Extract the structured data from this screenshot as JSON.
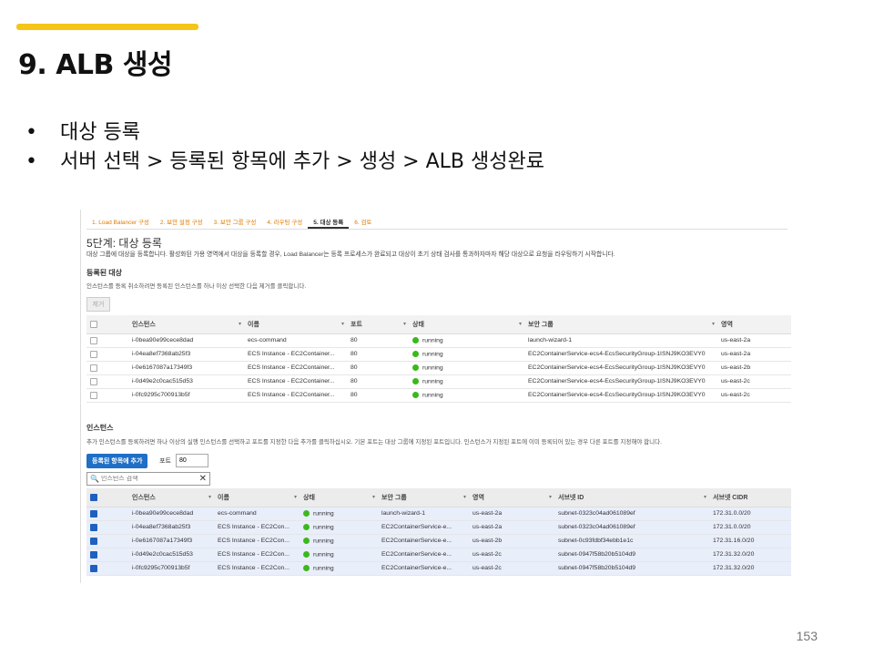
{
  "slide": {
    "title": "9. ALB 생성",
    "bullets": [
      "대상 등록",
      "서버 선택 > 등록된 항목에 추가  > 생성 > ALB 생성완료"
    ],
    "page_number": "153",
    "accent_color": "#f5c518"
  },
  "wizard": {
    "tabs": [
      "1. Load Balancer 구성",
      "2. 보안 설정 구성",
      "3. 보안 그룹 구성",
      "4. 라우팅 구성",
      "5. 대상 등록",
      "6. 검토"
    ],
    "active_tab": "5. 대상 등록",
    "step_title": "5단계: 대상 등록",
    "step_desc": "대상 그룹에 대상을 등록합니다. 활성화된 가용 영역에서 대상을 등록할 경우, Load Balancer는 등록 프로세스가 완료되고 대상이 초기 상태 검사를 통과하자마자 해당 대상으로 요청을 라우팅하기 시작합니다."
  },
  "registered": {
    "heading": "등록된 대상",
    "desc": "인스턴스를 등록 취소하려면 등록된 인스턴스를 하나 이상 선택한 다음 제거를 클릭합니다.",
    "remove_label": "제거",
    "columns": [
      "인스턴스",
      "이름",
      "포트",
      "상태",
      "보안 그룹",
      "영역"
    ],
    "rows": [
      [
        "i-0bea90e99cece8dad",
        "ecs-command",
        "80",
        "running",
        "launch-wizard-1",
        "us-east-2a"
      ],
      [
        "i-04ea8ef7368ab25f3",
        "ECS Instance - EC2Container...",
        "80",
        "running",
        "EC2ContainerService-ecs4-EcsSecurityGroup-1ISNJ9KO3EVY0",
        "us-east-2a"
      ],
      [
        "i-0e6167087a17349f3",
        "ECS Instance - EC2Container...",
        "80",
        "running",
        "EC2ContainerService-ecs4-EcsSecurityGroup-1ISNJ9KO3EVY0",
        "us-east-2b"
      ],
      [
        "i-0d49e2c0cac515d53",
        "ECS Instance - EC2Container...",
        "80",
        "running",
        "EC2ContainerService-ecs4-EcsSecurityGroup-1ISNJ9KO3EVY0",
        "us-east-2c"
      ],
      [
        "i-0fc9295c700913b5f",
        "ECS Instance - EC2Container...",
        "80",
        "running",
        "EC2ContainerService-ecs4-EcsSecurityGroup-1ISNJ9KO3EVY0",
        "us-east-2c"
      ]
    ]
  },
  "instances": {
    "heading": "인스턴스",
    "desc": "추가 인스턴스를 등록하려면 하나 이상의 실행 인스턴스를 선택하고 포트를 지정한 다음 추가를 클릭하십시오. 기본 포트는 대상 그룹에 지정된 포트입니다. 인스턴스가 지정된 포트에 이미 등록되어 있는 경우 다른 포트를 지정해야 합니다.",
    "add_label": "등록된 항목에 추가",
    "port_label": "포트",
    "port_value": "80",
    "search_placeholder": "인스턴스 검색",
    "columns": [
      "인스턴스",
      "이름",
      "상태",
      "보안 그룹",
      "영역",
      "서브넷 ID",
      "서브넷 CIDR"
    ],
    "rows": [
      [
        "i-0bea90e99cece8dad",
        "ecs-command",
        "running",
        "launch-wizard-1",
        "us-east-2a",
        "subnet-0323c04ad061089ef",
        "172.31.0.0/20"
      ],
      [
        "i-04ea8ef7368ab25f3",
        "ECS Instance - EC2Con...",
        "running",
        "EC2ContainerService-e...",
        "us-east-2a",
        "subnet-0323c04ad061089ef",
        "172.31.0.0/20"
      ],
      [
        "i-0e6167087a17349f3",
        "ECS Instance - EC2Con...",
        "running",
        "EC2ContainerService-e...",
        "us-east-2b",
        "subnet-0c93fdbf34ebb1e1c",
        "172.31.16.0/20"
      ],
      [
        "i-0d49e2c0cac515d53",
        "ECS Instance - EC2Con...",
        "running",
        "EC2ContainerService-e...",
        "us-east-2c",
        "subnet-0947f58b20b5104d9",
        "172.31.32.0/20"
      ],
      [
        "i-0fc9295c700913b5f",
        "ECS Instance - EC2Con...",
        "running",
        "EC2ContainerService-e...",
        "us-east-2c",
        "subnet-0947f58b20b5104d9",
        "172.31.32.0/20"
      ]
    ]
  }
}
